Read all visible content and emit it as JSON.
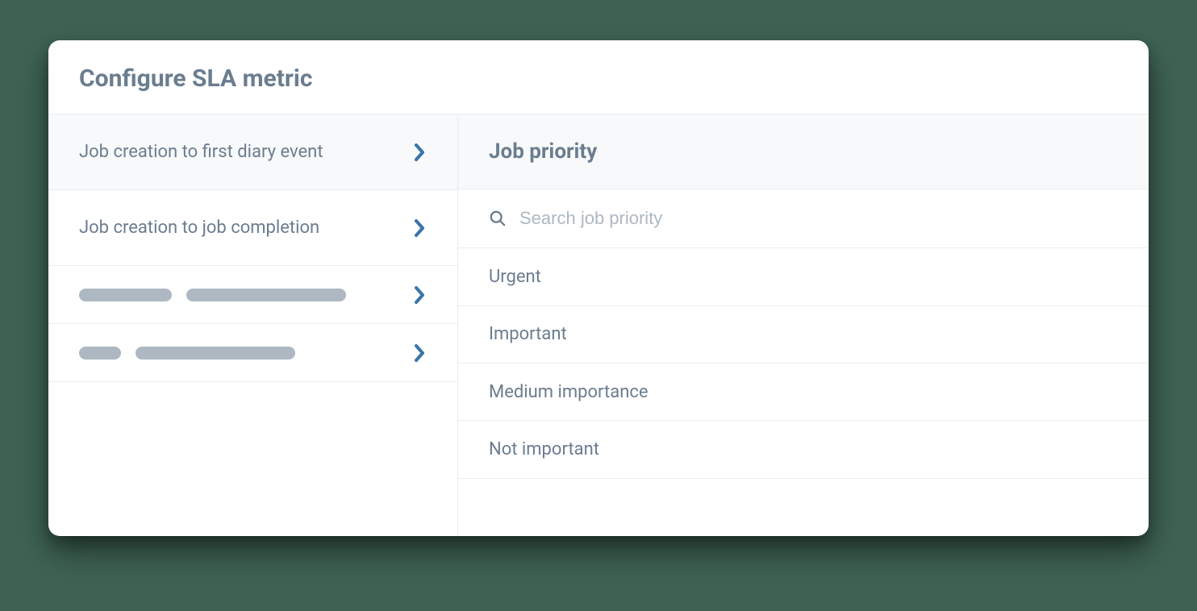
{
  "header": {
    "title": "Configure SLA metric"
  },
  "metrics": {
    "items": [
      {
        "label": "Job creation to first diary event",
        "selected": true,
        "placeholder": false
      },
      {
        "label": "Job creation to job completion",
        "selected": false,
        "placeholder": false
      },
      {
        "label": "",
        "selected": false,
        "placeholder": true
      },
      {
        "label": "",
        "selected": false,
        "placeholder": true
      }
    ]
  },
  "rightPanel": {
    "title": "Job priority",
    "search": {
      "placeholder": "Search job priority",
      "value": ""
    },
    "priorities": [
      {
        "label": "Urgent"
      },
      {
        "label": "Important"
      },
      {
        "label": "Medium importance"
      },
      {
        "label": "Not important"
      }
    ]
  }
}
